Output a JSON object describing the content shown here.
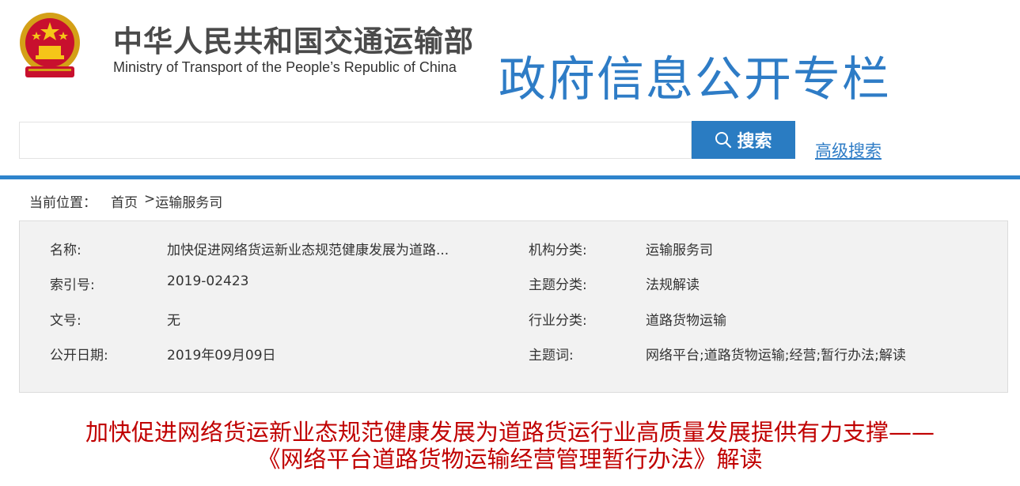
{
  "header": {
    "ministry_cn": "中华人民共和国交通运输部",
    "ministry_en": "Ministry of Transport of the People’s Republic of China",
    "column_title": "政府信息公开专栏"
  },
  "search": {
    "placeholder": "",
    "value": "",
    "button_label": "搜索",
    "advanced_label": "高级搜索"
  },
  "breadcrumb": {
    "prefix": "当前位置：",
    "home": "首页",
    "separator": ">",
    "current": "运输服务司"
  },
  "info": {
    "name_label": "名称:",
    "name_value": "加快促进网络货运新业态规范健康发展为道路...",
    "index_label": "索引号:",
    "index_value": "2019-02423",
    "doc_label": "文号:",
    "doc_value": "无",
    "date_label": "公开日期:",
    "date_value": "2019年09月09日",
    "org_label": "机构分类:",
    "org_value": "运输服务司",
    "topic_label": "主题分类:",
    "topic_value": "法规解读",
    "industry_label": "行业分类:",
    "industry_value": "道路货物运输",
    "keywords_label": "主题词:",
    "keywords_value": "网络平台;道路货物运输;经营;暂行办法;解读"
  },
  "article": {
    "title_line1": "加快促进网络货运新业态规范健康发展为道路货运行业高质量发展提供有力支撑——",
    "title_line2": "《网络平台道路货物运输经营管理暂行办法》解读"
  },
  "colors": {
    "brand_blue": "#2e7cc6",
    "button_blue": "#2a7cc2",
    "title_red": "#c00000"
  },
  "icons": {
    "emblem": "national-emblem-icon",
    "search": "search-icon"
  }
}
